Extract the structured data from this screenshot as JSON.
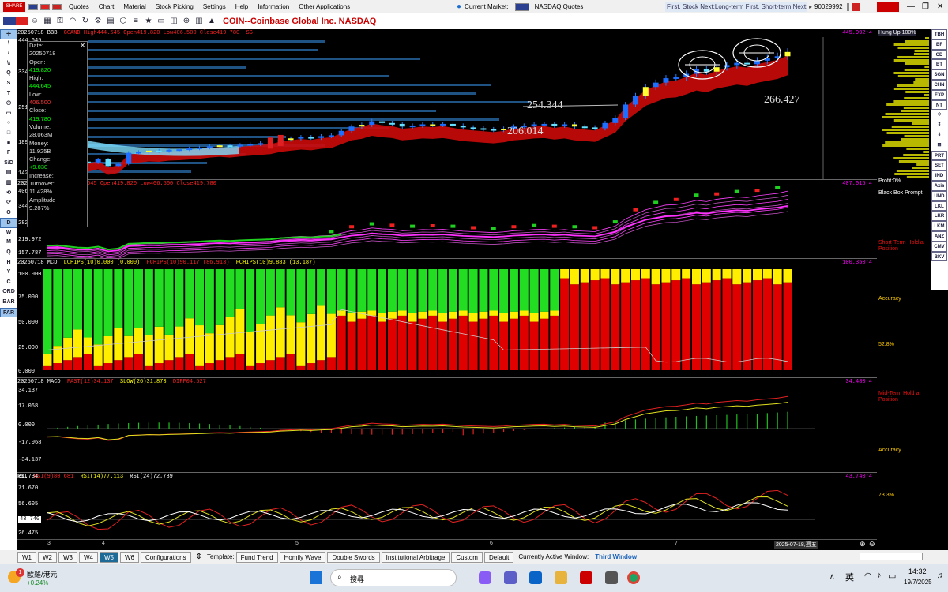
{
  "menubar": {
    "items": [
      "Quotes",
      "Chart",
      "Material",
      "Stock Picking",
      "Settings",
      "Help",
      "Information",
      "Other Applications"
    ],
    "current_market_label": "Current Market:",
    "market_name": "NASDAQ Quotes",
    "ticker_text": "First, Stock Next;Long-term First, Short-term Next; Op",
    "account": "90029992"
  },
  "toolbar": {
    "title": "COIN--Coinbase Global Inc.  NASDAQ"
  },
  "left_tools": [
    "✛",
    "\\",
    "/",
    "\\\\",
    "Q",
    "S",
    "T",
    "◷",
    "▭",
    "○",
    "□",
    "■",
    "F",
    "S/D",
    "▤",
    "▥",
    "⟲",
    "⟳",
    "O",
    "D",
    "W",
    "M",
    "Q",
    "H",
    "Y",
    "C",
    "ORD",
    "BAR",
    "FAR"
  ],
  "right_tools": [
    "TBH",
    "BF",
    "CD",
    "BT",
    "SGN",
    "CHN",
    "EXP",
    "NT",
    "◇",
    "⇕",
    "⇕",
    "⊞",
    "PRT",
    "SET",
    "IND",
    "Axis",
    "UND",
    "LKL",
    "LKR",
    "LKM",
    "ANZ",
    "CMV",
    "BKV"
  ],
  "popup": {
    "date_label": "Date:",
    "date": "20250718",
    "open_label": "Open:",
    "open": "419.820",
    "high_label": "High:",
    "high": "444.645",
    "low_label": "Low:",
    "low": "406.500",
    "close_label": "Close:",
    "close": "419.780",
    "volume_label": "Volume:",
    "volume": "28.063M",
    "money_label": "Money:",
    "money": "11.925B",
    "change_label": "Change:",
    "change": "+9.030",
    "increase_label": "Increase:",
    "increase": "",
    "turnover_label": "Turnover:",
    "turnover": "11.428%",
    "amplitude_label": "Amplitude",
    "amplitude": "9.287%"
  },
  "panes": {
    "bbb": {
      "h1": "20250718 BBB",
      "h2": "GCAND High444.645 Open419.820 Low406.500 Close419.780",
      "h3": "SS",
      "value": "445.992↑4",
      "y": [
        "444.645",
        "334.599",
        "251.789",
        "189.473",
        "142.580"
      ],
      "ann1": "254.344",
      "ann2": "206.014",
      "ann3": "266.427"
    },
    "tb": {
      "h1": "20250718 TB",
      "h2": "High444.645 Open419.820 Low406.500 Close419.780",
      "value": "407.015↑4",
      "y": [
        "406.526",
        "344.341",
        "282.156",
        "219.972",
        "157.787"
      ]
    },
    "mcd": {
      "h1": "20250718 MCD",
      "h2": "LCHIPS(10)0.000 (0.000)",
      "h3": "FCHIPS(10)90.117 (86.913)",
      "h4": "FCHIPS(10)9.883 (13.187)",
      "value": "100.350↑4",
      "y": [
        "100.000",
        "75.000",
        "50.000",
        "25.000",
        "0.000"
      ]
    },
    "macd": {
      "h1": "20250718 MACD",
      "h2": "FAST(12)34.137",
      "h3": "SLOW(26)31.873",
      "h4": "DIFF04.527",
      "value": "34.480↑4",
      "y": [
        "34.137",
        "17.068",
        "0.000",
        "-17.068",
        "-34.137"
      ]
    },
    "rsi": {
      "h1": "RSI",
      "h2": "RSI(9)80.681",
      "h3": "RSI(14)77.113",
      "h4": "RSI(24)72.739",
      "value": "43.740↑4",
      "y": [
        "86.734",
        "71.670",
        "56.605",
        "43.740",
        "26.475"
      ]
    }
  },
  "right_panel": {
    "hung_up": "Hung Up:100%",
    "profit": "Profit:0%",
    "black_box": "Black Box Prompt",
    "short_term": "Short-Term Hold a Position",
    "accuracy1": "Accuracy",
    "pct1": "52.8%",
    "mid_term": "Mid-Term Hold a Position",
    "accuracy2": "Accuracy",
    "pct2": "73.3%"
  },
  "time_axis": [
    "3",
    "4",
    "5",
    "6",
    "7"
  ],
  "time_cursor": "2025-07-18,週五",
  "bottombar": {
    "tabs": [
      "W1",
      "W2",
      "W3",
      "W4",
      "W5",
      "W6"
    ],
    "config": "Configurations",
    "template_label": "Template:",
    "templates": [
      "Fund Trend",
      "Homily Wave",
      "Double Swords",
      "Institutional Arbitrage",
      "Custom",
      "Default"
    ],
    "active_label": "Currently Active Window:",
    "active_window": "Third Window"
  },
  "taskbar": {
    "stock_name": "歐羅/港元",
    "stock_change": "+0.24%",
    "search": "搜尋",
    "lang": "英",
    "time": "14:32",
    "date": "19/7/2025",
    "badge": "1"
  },
  "chart_data": {
    "type": "candlestick",
    "title": "COIN--Coinbase Global Inc.  NASDAQ",
    "last": {
      "date": "20250718",
      "open": 419.82,
      "high": 444.645,
      "low": 406.5,
      "close": 419.78,
      "volume": "28.063M"
    },
    "ylim": [
      142.58,
      444.645
    ],
    "annotations": [
      254.344,
      206.014,
      266.427
    ],
    "close_series": [
      180,
      182,
      176,
      170,
      168,
      175,
      160,
      165,
      190,
      192,
      195,
      194,
      197,
      198,
      200,
      202,
      205,
      207,
      205,
      208,
      210,
      212,
      214,
      220,
      223,
      226,
      224,
      228,
      230,
      240,
      250,
      254,
      262,
      258,
      256,
      250,
      252,
      255,
      254,
      256,
      252,
      248,
      246,
      244,
      242,
      245,
      250,
      252,
      255,
      256,
      252,
      255,
      250,
      248,
      246,
      258,
      270,
      300,
      320,
      340,
      350,
      360,
      362,
      370,
      380,
      375,
      385,
      390,
      395,
      392,
      400,
      405,
      410,
      419.78
    ]
  }
}
